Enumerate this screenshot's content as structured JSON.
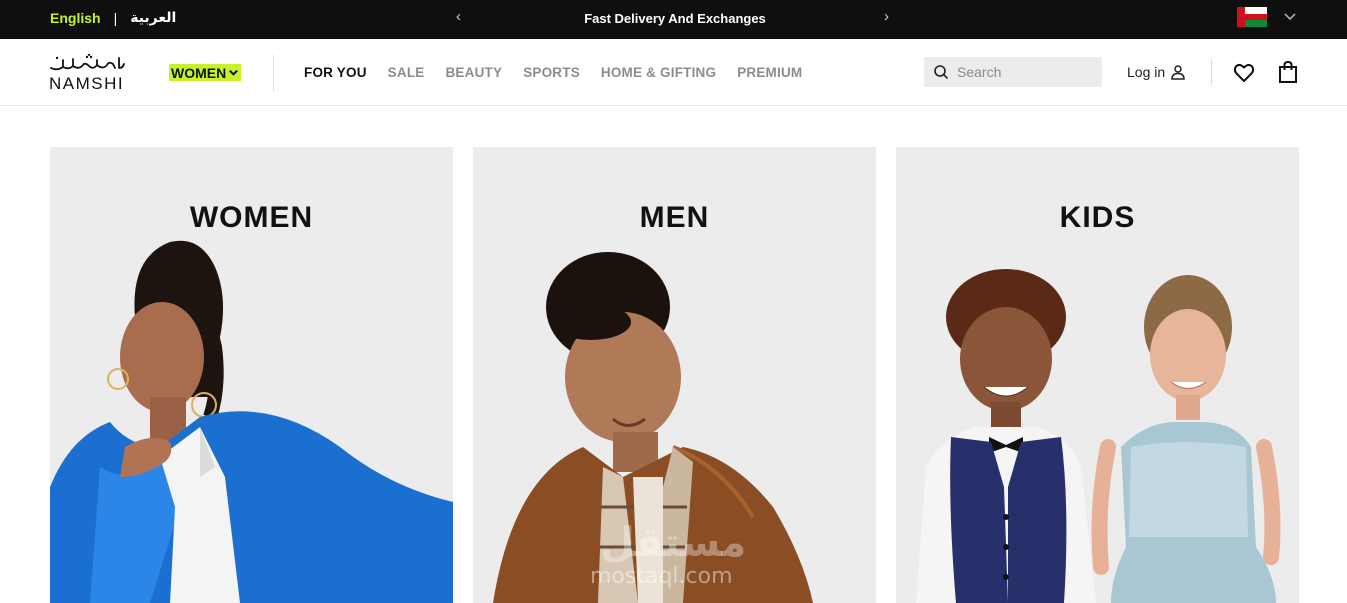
{
  "topbar": {
    "lang_en": "English",
    "lang_separator": "|",
    "lang_ar": "العربية",
    "promo_prev": "‹",
    "promo_text": "Fast Delivery And Exchanges",
    "promo_next": "›",
    "country_flag": "oman-flag-icon"
  },
  "nav": {
    "logo_en": "NAMSHI",
    "logo_ar": "نمشي",
    "department": "WOMEN",
    "menu": [
      {
        "label": "FOR YOU",
        "active": true
      },
      {
        "label": "SALE",
        "active": false
      },
      {
        "label": "BEAUTY",
        "active": false
      },
      {
        "label": "SPORTS",
        "active": false
      },
      {
        "label": "HOME & GIFTING",
        "active": false
      },
      {
        "label": "PREMIUM",
        "active": false
      }
    ],
    "search_placeholder": "Search",
    "login_label": "Log in"
  },
  "categories": [
    {
      "title": "WOMEN"
    },
    {
      "title": "MEN"
    },
    {
      "title": "KIDS"
    }
  ],
  "watermark": {
    "ar": "مستقل",
    "en": "mostaql.com"
  },
  "colors": {
    "accent": "#c5f22a",
    "topbar_bg": "#0f0f0f",
    "card_bg": "#ececec"
  }
}
